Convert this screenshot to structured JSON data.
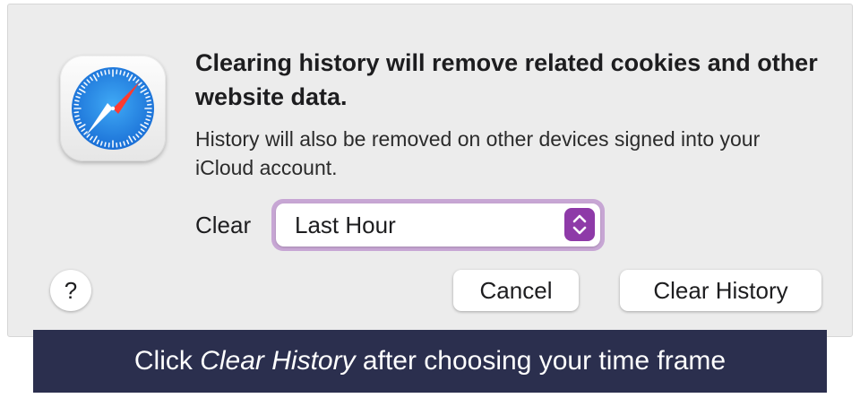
{
  "dialog": {
    "title": "Clearing history will remove related cookies and other website data.",
    "subtitle": "History will also be removed on other devices signed into your iCloud account.",
    "app_icon": "safari-compass-icon",
    "clear_label": "Clear",
    "clear_select": {
      "value": "Last Hour"
    },
    "help_label": "?",
    "cancel_label": "Cancel",
    "clear_history_label": "Clear History"
  },
  "caption": {
    "prefix": "Click ",
    "emphasis": "Clear History",
    "suffix": " after choosing your time frame"
  },
  "colors": {
    "dialog_bg": "#ececec",
    "accent": "#8e3aa8",
    "focus_ring": "#c7a6d4",
    "caption_bg": "#2b2f4e"
  }
}
